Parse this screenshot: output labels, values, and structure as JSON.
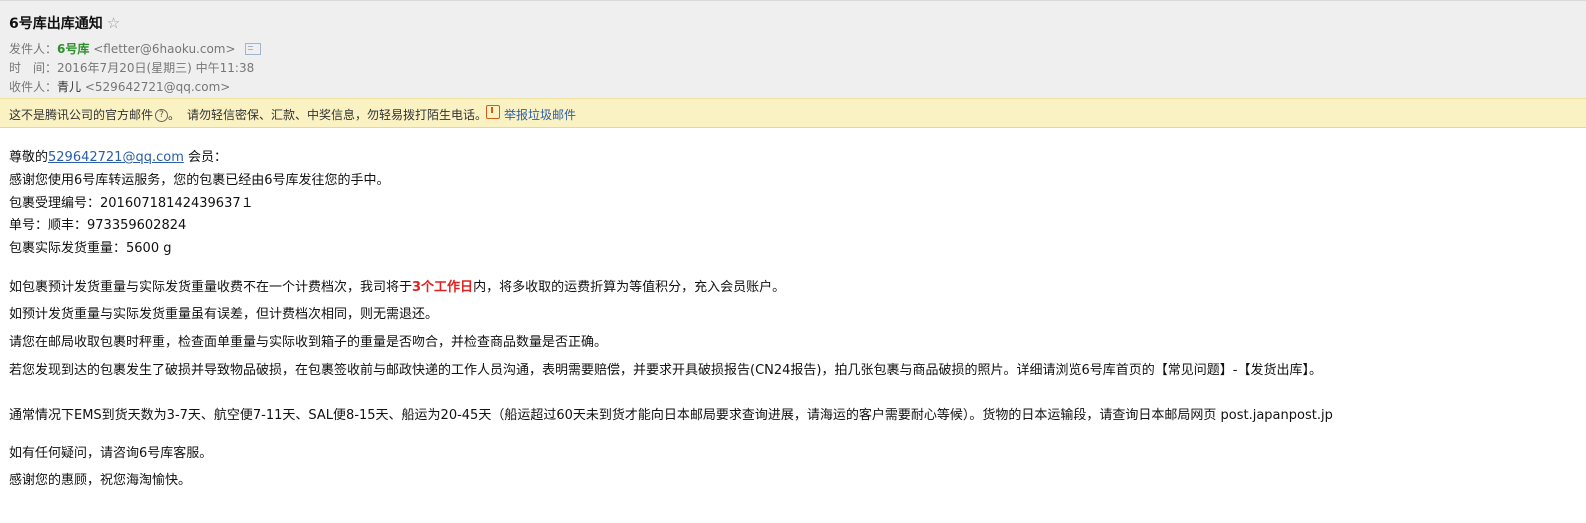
{
  "email": {
    "subject": "6号库出库通知",
    "star_glyph": "☆",
    "from_label": "发件人：",
    "from_name": "6号库",
    "from_address": "<fletter@6haoku.com>",
    "time_label": "时　间：",
    "time_value": "2016年7月20日(星期三) 中午11:38",
    "to_label": "收件人：",
    "to_name": "青儿",
    "to_address": "<529642721@qq.com>"
  },
  "warning": {
    "notice": "这不是腾讯公司的官方邮件",
    "question_glyph": "?",
    "notice_end": "。",
    "advice": "请勿轻信密保、汇款、中奖信息，勿轻易拨打陌生电话。",
    "report_link": "举报垃圾邮件"
  },
  "body": {
    "greeting_prefix": "尊敬的",
    "greeting_email": "529642721@qq.com",
    "greeting_suffix": " 会员：",
    "line_thanks": "感谢您使用6号库转运服务，您的包裹已经由6号库发往您的手中。",
    "line_id": "包裹受理编号：20160718142439637１",
    "line_tracking": "单号：顺丰：973359602824",
    "line_weight": "包裹实际发货重量：5600 g",
    "para1_a": "如包裹预计发货重量与实际发货重量收费不在一个计费档次，我司将于",
    "para1_highlight": "3个工作日",
    "para1_b": "内，将多收取的运费折算为等值积分，充入会员账户。",
    "para2": "如预计发货重量与实际发货重量虽有误差，但计费档次相同，则无需退还。",
    "para3": "请您在邮局收取包裹时秤重，检查面单重量与实际收到箱子的重量是否吻合，并检查商品数量是否正确。",
    "para4": "若您发现到达的包裹发生了破损并导致物品破损，在包裹签收前与邮政快递的工作人员沟通，表明需要赔偿，并要求开具破损报告(CN24报告)，拍几张包裹与商品破损的照片。详细请浏览6号库首页的【常见问题】-【发货出库】。",
    "para5": "通常情况下EMS到货天数为3-7天、航空便7-11天、SAL便8-15天、船运为20-45天（船运超过60天未到货才能向日本邮局要求查询进展，请海运的客户需要耐心等候）。货物的日本运输段，请查询日本邮局网页 post.japanpost.jp",
    "para6": "如有任何疑问，请咨询6号库客服。",
    "para7": "感谢您的惠顾，祝您海淘愉快。"
  }
}
